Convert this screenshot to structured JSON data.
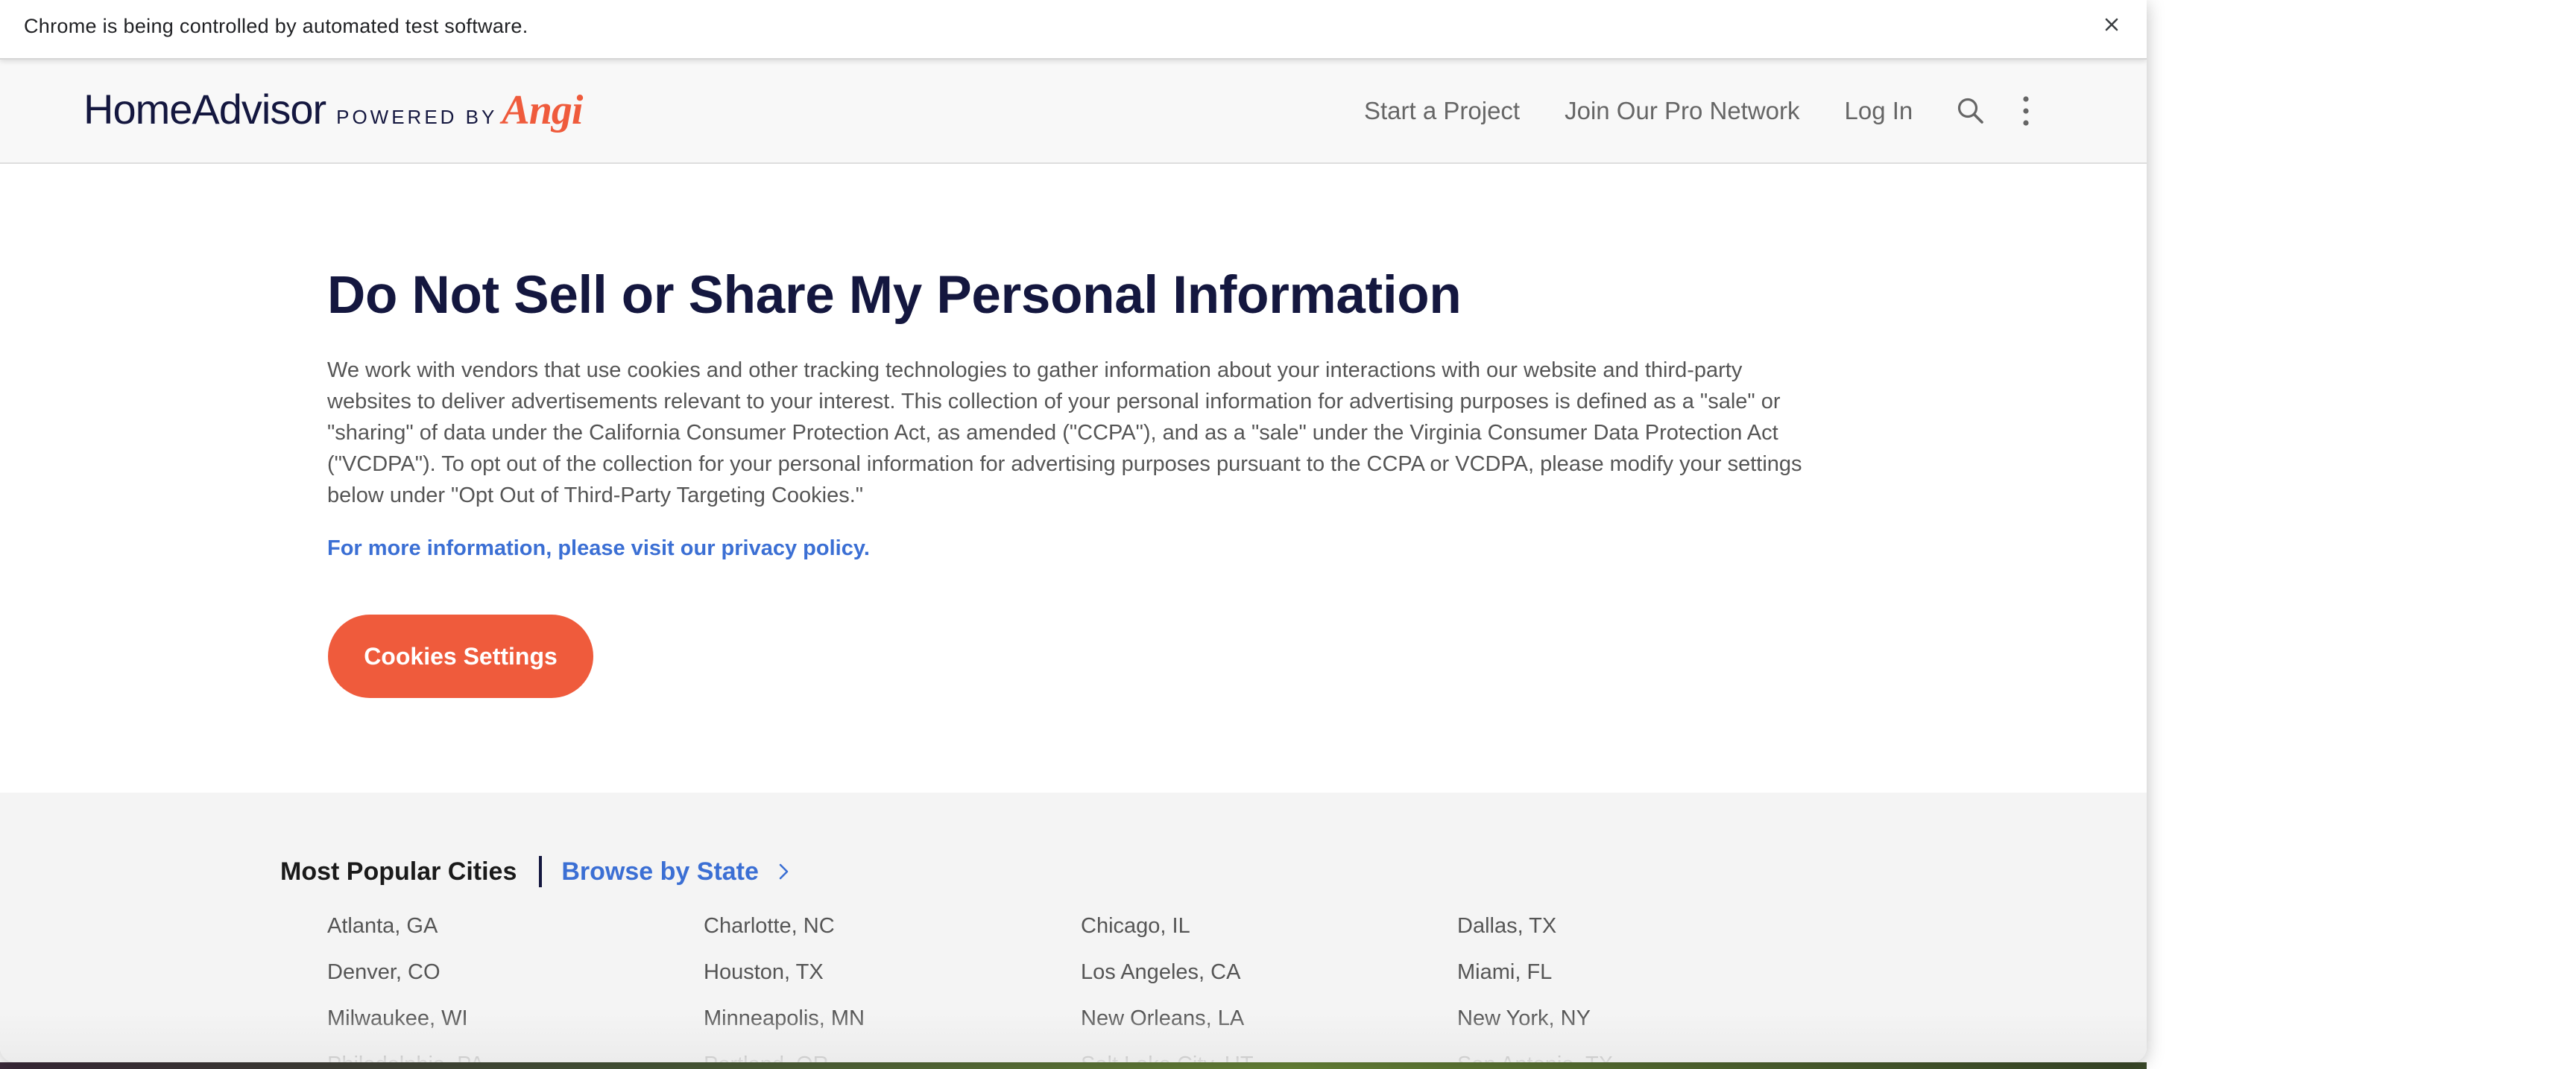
{
  "infobar": {
    "message": "Chrome is being controlled by automated test software.",
    "close_icon": "close-icon"
  },
  "header": {
    "logo": {
      "brand": "HomeAdvisor",
      "powered_by": "POWERED BY",
      "partner": "Angi"
    },
    "nav": {
      "start_project": "Start a Project",
      "join_pro": "Join Our Pro Network",
      "log_in": "Log In",
      "search_icon": "search-icon",
      "more_icon": "more-vertical-icon"
    }
  },
  "main": {
    "title": "Do Not Sell or Share My Personal Information",
    "intro": "We work with vendors that use cookies and other tracking technologies to gather information about your interactions with our website and third-party websites to deliver advertisements relevant to your interest. This collection of your personal information for advertising purposes is defined as a \"sale\" or \"sharing\" of data under the California Consumer Protection Act, as amended (\"CCPA\"), and as a \"sale\" under the Virginia Consumer Data Protection Act (\"VCDPA\"). To opt out of the collection for your personal information for advertising purposes pursuant to the CCPA or VCDPA, please modify your settings below under \"Opt Out of Third-Party Targeting Cookies.\"",
    "privacy_link": "For more information, please visit our privacy policy.",
    "cookies_button": "Cookies Settings"
  },
  "footer": {
    "most_popular": "Most Popular Cities",
    "browse_by_state": "Browse by State",
    "cities": [
      [
        "Atlanta, GA",
        "Charlotte, NC",
        "Chicago, IL",
        "Dallas, TX"
      ],
      [
        "Denver, CO",
        "Houston, TX",
        "Los Angeles, CA",
        "Miami, FL"
      ],
      [
        "Milwaukee, WI",
        "Minneapolis, MN",
        "New Orleans, LA",
        "New York, NY"
      ],
      [
        "Philadelphia, PA",
        "Portland, OR",
        "Salt Lake City, UT",
        "San Antonio, TX"
      ]
    ]
  },
  "colors": {
    "brand_navy": "#14173f",
    "accent_orange": "#ef5b3c",
    "link_blue": "#3b6fd4",
    "body_text": "#555555",
    "footer_bg": "#f4f4f4"
  }
}
